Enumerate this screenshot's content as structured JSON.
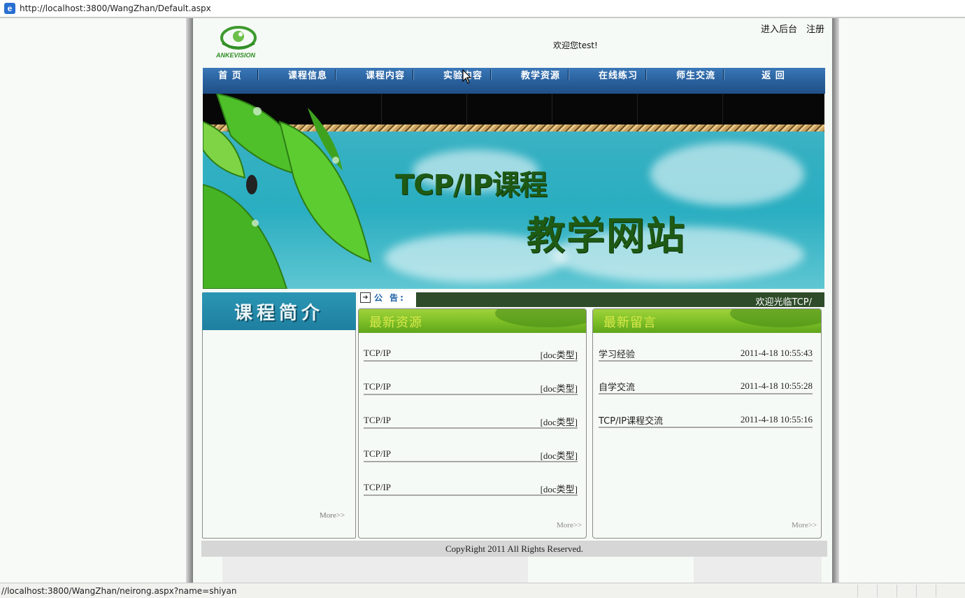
{
  "browser": {
    "address_url": "http://localhost:3800/WangZhan/Default.aspx",
    "status_text": "//localhost:3800/WangZhan/neirong.aspx?name=shiyan"
  },
  "header": {
    "logo_text": "ANKEVISION",
    "links": [
      "进入后台",
      "注册"
    ],
    "welcome": "欢迎您test!"
  },
  "nav": {
    "items": [
      "首 页",
      "课程信息",
      "课程内容",
      "实验内容",
      "教学资源",
      "在线练习",
      "师生交流",
      "返 回"
    ]
  },
  "banner": {
    "title_line1": "TCP/IP课程",
    "title_line2": "教学网站"
  },
  "intro": {
    "title": "课程简介",
    "more": "More>>"
  },
  "notice": {
    "label": "公 告:",
    "text": "欢迎光临TCP/"
  },
  "resources": {
    "title": "最新资源",
    "items": [
      {
        "name": "TCP/IP",
        "type": "[doc类型]"
      },
      {
        "name": "TCP/IP",
        "type": "[doc类型]"
      },
      {
        "name": "TCP/IP",
        "type": "[doc类型]"
      },
      {
        "name": "TCP/IP",
        "type": "[doc类型]"
      },
      {
        "name": "TCP/IP",
        "type": "[doc类型]"
      }
    ],
    "more": "More>>"
  },
  "messages": {
    "title": "最新留言",
    "items": [
      {
        "name": "学习经验",
        "time": "2011-4-18 10:55:43"
      },
      {
        "name": "自学交流",
        "time": "2011-4-18 10:55:28"
      },
      {
        "name": "TCP/IP课程交流",
        "time": "2011-4-18 10:55:16"
      }
    ],
    "more": "More>>"
  },
  "footer": {
    "copyright": "CopyRight 2011 All Rights Reserved."
  }
}
